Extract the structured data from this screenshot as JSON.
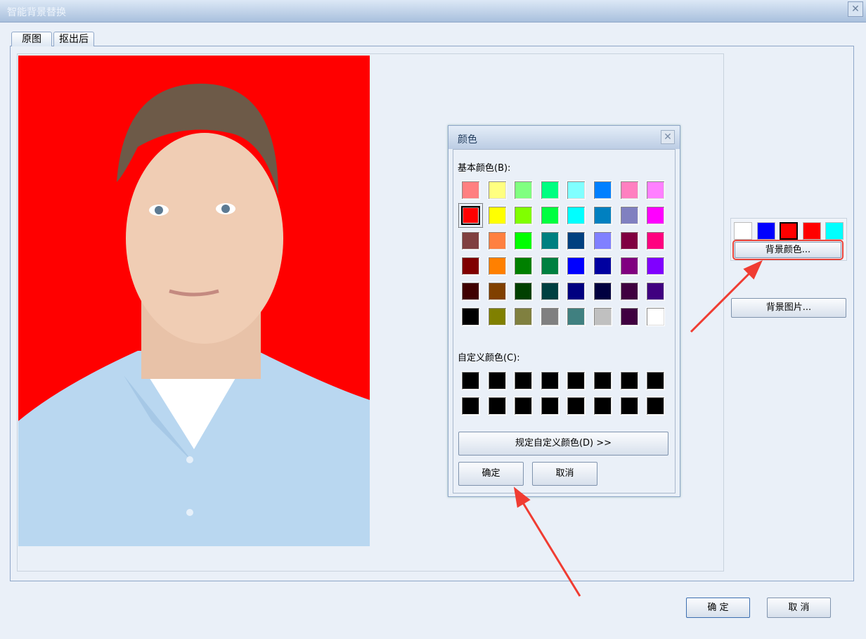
{
  "window": {
    "title": "智能背景替换",
    "close": "✕"
  },
  "tabs": [
    {
      "label": "原图"
    },
    {
      "label": "抠出后"
    }
  ],
  "color_dialog": {
    "title": "颜色",
    "close": "✕",
    "basic_label": "基本颜色(B):",
    "custom_label": "自定义颜色(C):",
    "define_button": "规定自定义颜色(D) >>",
    "ok": "确定",
    "cancel": "取消",
    "selected_basic": "#FF0000",
    "basic_colors": [
      "#FF8080",
      "#FFFF80",
      "#80FF80",
      "#00FF80",
      "#80FFFF",
      "#0080FF",
      "#FF80C0",
      "#FF80FF",
      "#FF0000",
      "#FFFF00",
      "#80FF00",
      "#00FF40",
      "#00FFFF",
      "#0080C0",
      "#8080C0",
      "#FF00FF",
      "#804040",
      "#FF8040",
      "#00FF00",
      "#008080",
      "#004080",
      "#8080FF",
      "#800040",
      "#FF0080",
      "#800000",
      "#FF8000",
      "#008000",
      "#008040",
      "#0000FF",
      "#0000A0",
      "#800080",
      "#8000FF",
      "#400000",
      "#804000",
      "#004000",
      "#004040",
      "#000080",
      "#000040",
      "#400040",
      "#400080",
      "#000000",
      "#808000",
      "#808040",
      "#808080",
      "#408080",
      "#C0C0C0",
      "#400040",
      "#FFFFFF"
    ],
    "custom_colors": [
      "#000000",
      "#000000",
      "#000000",
      "#000000",
      "#000000",
      "#000000",
      "#000000",
      "#000000",
      "#000000",
      "#000000",
      "#000000",
      "#000000",
      "#000000",
      "#000000",
      "#000000",
      "#000000"
    ]
  },
  "right_panel": {
    "swatches": [
      "#FFFFFF",
      "#0000FF",
      "#FF0000",
      "#FF0000",
      "#00FFFF"
    ],
    "selected_swatch": 2,
    "bg_color_button": "背景颜色...",
    "bg_image_button": "背景图片..."
  },
  "footer": {
    "ok": "确 定",
    "cancel": "取 消"
  },
  "photo": {
    "background": "#FF0000"
  },
  "annotation_color": "#F03C32"
}
